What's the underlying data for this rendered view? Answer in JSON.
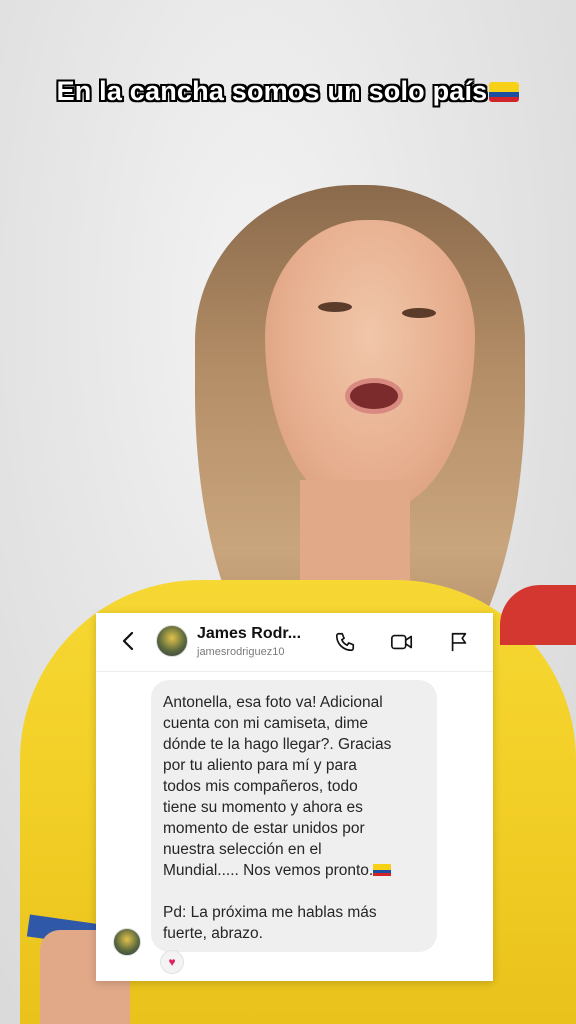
{
  "caption": {
    "text": "En la cancha somos un solo país"
  },
  "dm": {
    "contact_name": "James Rodr...",
    "contact_handle": "jamesrodriguez10",
    "message_lines": [
      "Antonella, esa foto va! Adicional",
      "cuenta con mi camiseta, dime",
      "dónde te la hago llegar?. Gracias",
      "por tu aliento para mí y para",
      "todos mis compañeros, todo",
      "tiene su momento y ahora es",
      "momento de estar unidos por",
      "nuestra selección en el",
      "Mundial..... Nos vemos pronto."
    ],
    "ps_lines": [
      "Pd: La próxima me hablas más",
      "fuerte, abrazo."
    ],
    "reaction": "♥",
    "icons": [
      "back-chevron-icon",
      "phone-icon",
      "video-camera-icon",
      "flag-icon"
    ]
  },
  "colors": {
    "shirt_yellow": "#f2cf26",
    "bubble_bg": "#efefef",
    "reaction_heart": "#e0245e"
  }
}
